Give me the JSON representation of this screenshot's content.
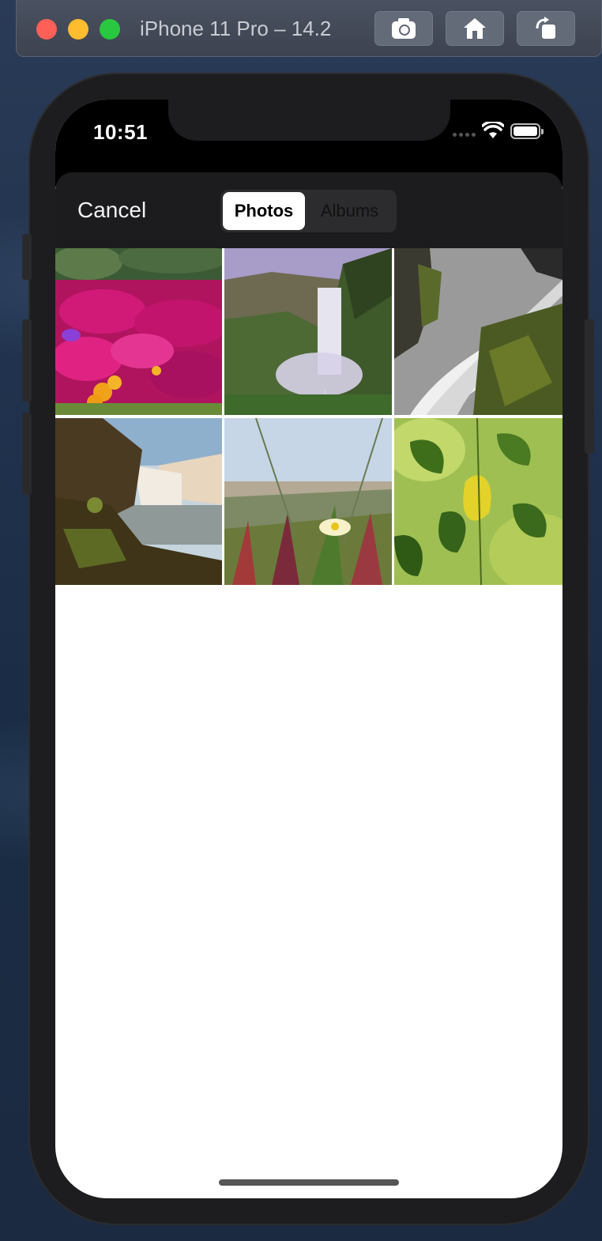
{
  "window": {
    "title": "iPhone 11 Pro – 14.2",
    "buttons": [
      {
        "name": "screenshot",
        "icon": "camera-icon"
      },
      {
        "name": "home",
        "icon": "home-icon"
      },
      {
        "name": "rotate",
        "icon": "rotate-icon"
      }
    ]
  },
  "status_bar": {
    "time": "10:51",
    "icons": [
      "cellular-signal-icon",
      "wifi-icon",
      "battery-icon"
    ]
  },
  "picker": {
    "cancel_label": "Cancel",
    "tabs": [
      {
        "label": "Photos",
        "selected": true
      },
      {
        "label": "Albums",
        "selected": false
      }
    ],
    "photos": [
      {
        "subject": "magenta flowers"
      },
      {
        "subject": "waterfall valley"
      },
      {
        "subject": "waterfall rocks"
      },
      {
        "subject": "cliff waterfall"
      },
      {
        "subject": "beach flower"
      },
      {
        "subject": "green leaves"
      }
    ]
  },
  "colors": {
    "sheet_background": "#1c1c1e",
    "segment_background": "#2c2c2e",
    "segment_selected": "#ffffff",
    "traffic_close": "#fe5f57",
    "traffic_minimize": "#febc2e",
    "traffic_maximize": "#28c840"
  }
}
